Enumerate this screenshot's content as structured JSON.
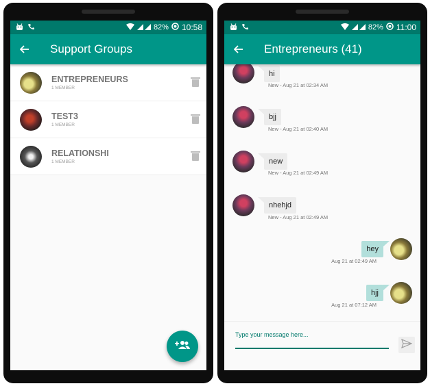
{
  "status_left": {
    "time": "10:58",
    "battery": "82%"
  },
  "status_right": {
    "time": "11:00",
    "battery": "82%"
  },
  "groups_screen": {
    "title": "Support Groups",
    "groups": [
      {
        "name": "ENTREPRENEURS",
        "members": "1 MEMBER"
      },
      {
        "name": "TEST3",
        "members": "1 MEMBER"
      },
      {
        "name": "RELATIONSHI",
        "members": "1 MEMBER"
      }
    ]
  },
  "chat_screen": {
    "title": "Entrepreneurs (41)",
    "incoming": [
      {
        "text": "hi",
        "meta": "New - Aug 21 at 02:34 AM"
      },
      {
        "text": "bjj",
        "meta": "New - Aug 21 at 02:40 AM"
      },
      {
        "text": "new",
        "meta": "New - Aug 21 at 02:49 AM"
      },
      {
        "text": "nhehjd",
        "meta": "New - Aug 21 at 02:49 AM"
      }
    ],
    "outgoing": [
      {
        "text": "hey",
        "meta": "Aug 21 at 02:49 AM"
      },
      {
        "text": "hjj",
        "meta": "Aug 21 at 07:12 AM"
      }
    ],
    "input_placeholder": "Type your message here..."
  },
  "colors": {
    "primary": "#009688",
    "primary_dark": "#00796b",
    "outgoing_bubble": "#b2dfdb",
    "incoming_bubble": "#ececec"
  },
  "icons": [
    "android-icon",
    "call-icon",
    "wifi-icon",
    "signal-icon",
    "battery-icon",
    "back-arrow-icon",
    "trash-icon",
    "group-add-icon",
    "send-icon"
  ]
}
